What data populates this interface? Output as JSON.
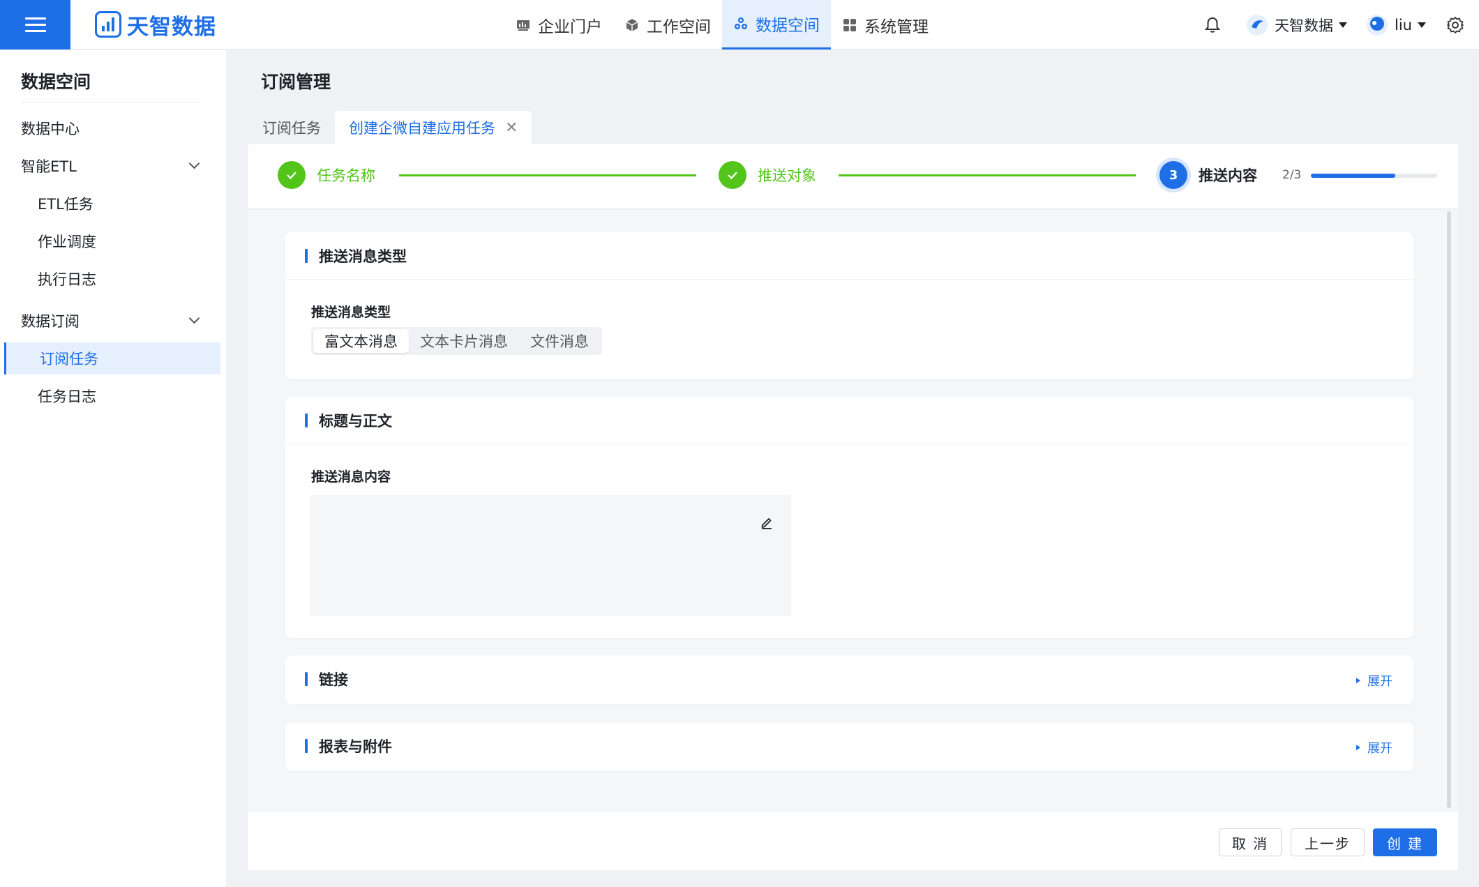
{
  "header": {
    "logo_text": "天智数据",
    "nav": [
      {
        "label": "企业门户",
        "icon": "chart-icon"
      },
      {
        "label": "工作空间",
        "icon": "cube-icon"
      },
      {
        "label": "数据空间",
        "icon": "cluster-icon",
        "active": true
      },
      {
        "label": "系统管理",
        "icon": "grid-icon"
      }
    ],
    "org_name": "天智数据",
    "user_name": "liu"
  },
  "sidebar": {
    "title": "数据空间",
    "items": [
      {
        "label": "数据中心",
        "level": 1
      },
      {
        "label": "智能ETL",
        "level": 1,
        "expandable": true
      },
      {
        "label": "ETL任务",
        "level": 2
      },
      {
        "label": "作业调度",
        "level": 2
      },
      {
        "label": "执行日志",
        "level": 2
      },
      {
        "label": "数据订阅",
        "level": 1,
        "expandable": true
      },
      {
        "label": "订阅任务",
        "level": 2,
        "active": true
      },
      {
        "label": "任务日志",
        "level": 2
      }
    ]
  },
  "main": {
    "page_title": "订阅管理",
    "tabs": [
      {
        "label": "订阅任务",
        "active": false
      },
      {
        "label": "创建企微自建应用任务",
        "active": true,
        "closable": true
      }
    ],
    "steps": [
      {
        "label": "任务名称",
        "status": "done"
      },
      {
        "label": "推送对象",
        "status": "done"
      },
      {
        "label": "推送内容",
        "status": "current",
        "number": "3"
      }
    ],
    "progress_text": "2/3",
    "progress_fraction": 0.67,
    "cards": {
      "message_type": {
        "title": "推送消息类型",
        "field_label": "推送消息类型",
        "options": [
          "富文本消息",
          "文本卡片消息",
          "文件消息"
        ],
        "selected": "富文本消息"
      },
      "title_body": {
        "title": "标题与正文",
        "field_label": "推送消息内容"
      },
      "links": {
        "title": "链接",
        "expand_label": "展开"
      },
      "reports": {
        "title": "报表与附件",
        "expand_label": "展开"
      }
    }
  },
  "footer": {
    "cancel_label": "取 消",
    "prev_label": "上一步",
    "create_label": "创 建"
  },
  "colors": {
    "primary": "#1e6fe6",
    "success": "#52c41a"
  }
}
